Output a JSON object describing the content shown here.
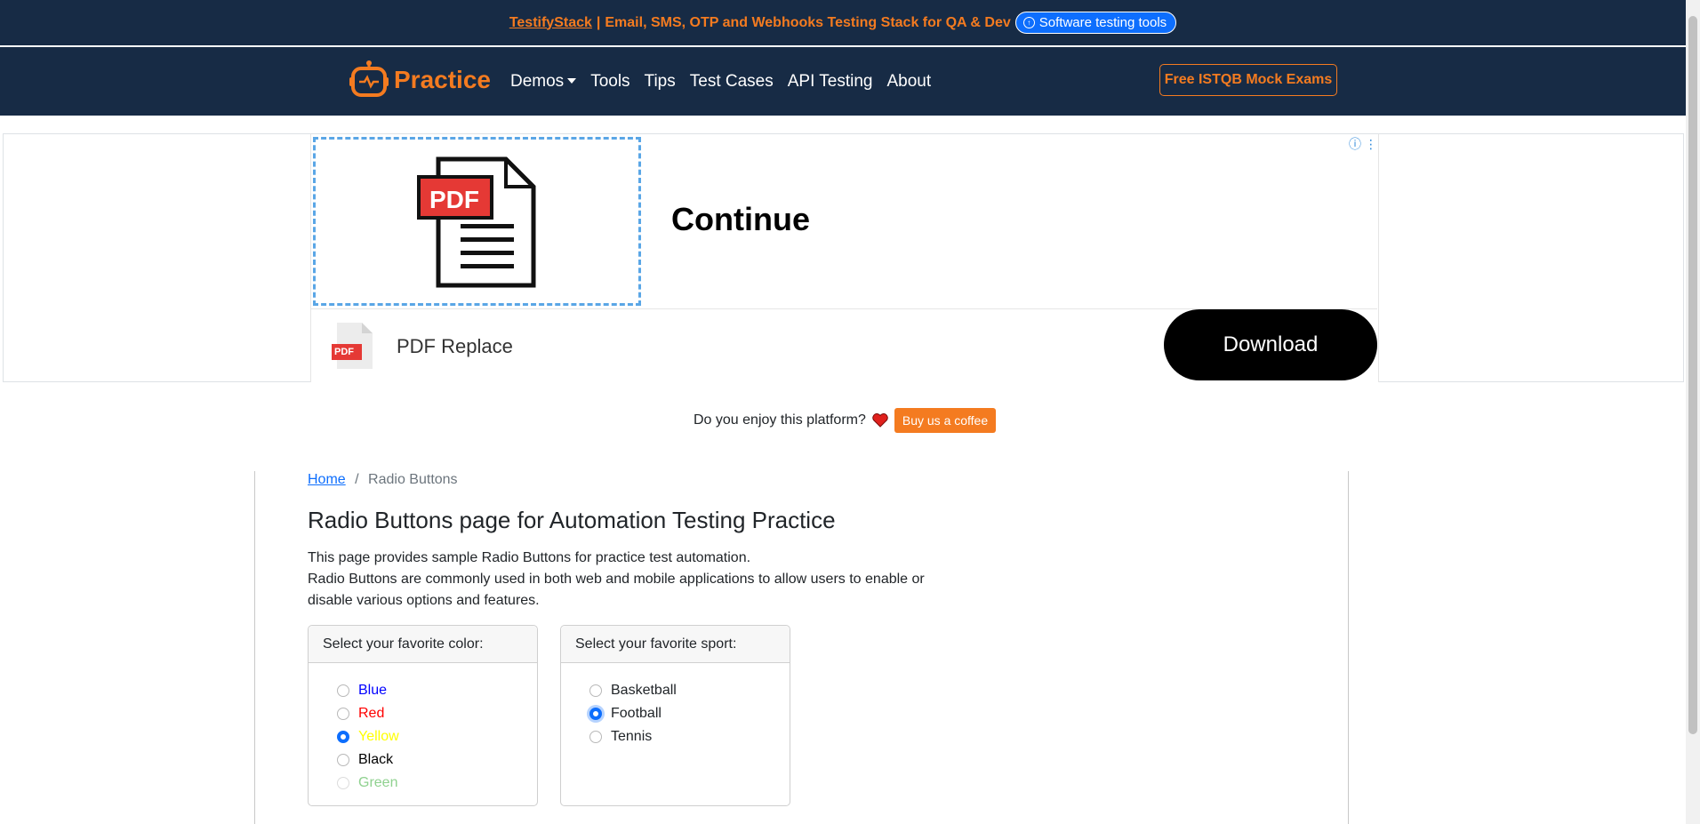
{
  "topbar": {
    "brand_link": "TestifyStack",
    "separator": "|",
    "message": "Email, SMS, OTP and Webhooks Testing Stack for QA & Dev",
    "tools_pill": "Software testing tools",
    "color_bg": "#172b45",
    "color_accent": "#f47b20"
  },
  "navbar": {
    "brand": "Practice",
    "links": [
      "Demos",
      "Tools",
      "Tips",
      "Test Cases",
      "API Testing",
      "About"
    ],
    "cta": "Free ISTQB Mock Exams"
  },
  "ad": {
    "image_label": "PDF",
    "headline": "Continue",
    "brand_icon_label": "PDF",
    "brand_name": "PDF Replace",
    "cta": "Download"
  },
  "enjoy": {
    "text": "Do you enjoy this platform?",
    "button": "Buy us a coffee"
  },
  "breadcrumb": {
    "home": "Home",
    "separator": "/",
    "current": "Radio Buttons"
  },
  "page": {
    "title": "Radio Buttons page for Automation Testing Practice",
    "desc_line1": "This page provides sample Radio Buttons for practice test automation.",
    "desc_line2": "Radio Buttons are commonly used in both web and mobile applications to allow users to enable or disable various options and features."
  },
  "color_card": {
    "header": "Select your favorite color:",
    "options": [
      {
        "label": "Blue",
        "color": "#0000ff",
        "checked": false,
        "disabled": false
      },
      {
        "label": "Red",
        "color": "#ff0000",
        "checked": false,
        "disabled": false
      },
      {
        "label": "Yellow",
        "color": "#ffff00",
        "checked": true,
        "disabled": false
      },
      {
        "label": "Black",
        "color": "#000000",
        "checked": false,
        "disabled": false
      },
      {
        "label": "Green",
        "color": "#8fd18f",
        "checked": false,
        "disabled": true
      }
    ]
  },
  "sport_card": {
    "header": "Select your favorite sport:",
    "options": [
      {
        "label": "Basketball",
        "checked": false
      },
      {
        "label": "Football",
        "checked": true
      },
      {
        "label": "Tennis",
        "checked": false
      }
    ]
  }
}
